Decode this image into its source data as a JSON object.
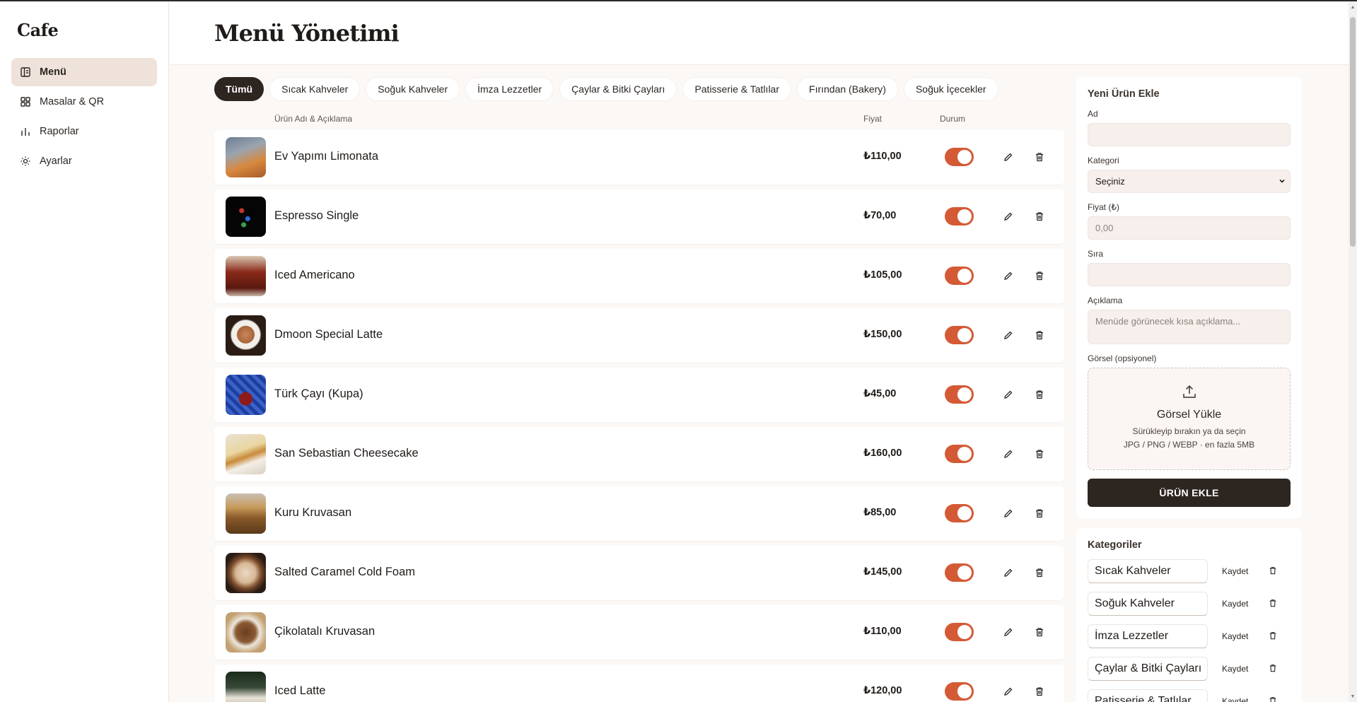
{
  "brand": "Cafe",
  "nav": [
    {
      "label": "Menü",
      "icon": "menu-book-icon",
      "active": true
    },
    {
      "label": "Masalar & QR",
      "icon": "grid-icon",
      "active": false
    },
    {
      "label": "Raporlar",
      "icon": "bar-chart-icon",
      "active": false
    },
    {
      "label": "Ayarlar",
      "icon": "sun-gear-icon",
      "active": false
    }
  ],
  "page_title": "Menü Yönetimi",
  "tabs": [
    "Tümü",
    "Sıcak Kahveler",
    "Soğuk Kahveler",
    "İmza Lezzetler",
    "Çaylar & Bitki Çayları",
    "Patisserie & Tatlılar",
    "Fırından (Bakery)",
    "Soğuk İçecekler"
  ],
  "columns": {
    "name": "Ürün Adı & Açıklama",
    "price": "Fiyat",
    "status": "Durum"
  },
  "items": [
    {
      "name": "Ev Yapımı Limonata",
      "price": "₺110,00",
      "active": true
    },
    {
      "name": "Espresso Single",
      "price": "₺70,00",
      "active": true
    },
    {
      "name": "Iced Americano",
      "price": "₺105,00",
      "active": true
    },
    {
      "name": "Dmoon Special Latte",
      "price": "₺150,00",
      "active": true
    },
    {
      "name": "Türk Çayı (Kupa)",
      "price": "₺45,00",
      "active": true
    },
    {
      "name": "San Sebastian Cheesecake",
      "price": "₺160,00",
      "active": true
    },
    {
      "name": "Kuru Kruvasan",
      "price": "₺85,00",
      "active": true
    },
    {
      "name": "Salted Caramel Cold Foam",
      "price": "₺145,00",
      "active": true
    },
    {
      "name": "Çikolatalı Kruvasan",
      "price": "₺110,00",
      "active": true
    },
    {
      "name": "Iced Latte",
      "price": "₺120,00",
      "active": true
    }
  ],
  "form": {
    "title": "Yeni Ürün Ekle",
    "name_label": "Ad",
    "name_value": "",
    "category_label": "Kategori",
    "category_value": "Seçiniz",
    "price_label": "Fiyat (₺)",
    "price_placeholder": "0,00",
    "order_label": "Sıra",
    "order_value": "",
    "desc_label": "Açıklama",
    "desc_placeholder": "Menüde görünecek kısa açıklama...",
    "image_label": "Görsel (opsiyonel)",
    "upload_title": "Görsel Yükle",
    "upload_sub": "Sürükleyip bırakın ya da seçin",
    "upload_formats": "JPG / PNG / WEBP · en fazla 5MB",
    "submit_label": "ÜRÜN EKLE"
  },
  "categories": {
    "title": "Kategoriler",
    "save_label": "Kaydet",
    "items": [
      "Sıcak Kahveler",
      "Soğuk Kahveler",
      "İmza Lezzetler",
      "Çaylar & Bitki Çayları",
      "Patisserie & Tatlılar"
    ]
  },
  "colors": {
    "accent": "#d45a35",
    "dark": "#2d2520",
    "background": "#fcf8f6",
    "active_nav": "#efe2da"
  }
}
